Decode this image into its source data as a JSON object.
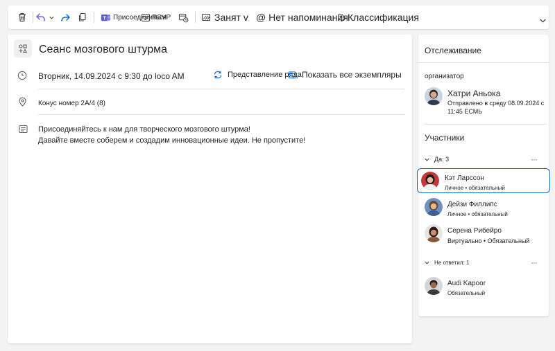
{
  "toolbar": {
    "join_label": "Присоединиться",
    "rsvp_label": "RSVP",
    "busy_label": "Занят v",
    "reminder_label": "@ Нет напоминания",
    "classify_label": "Классификация"
  },
  "event": {
    "title": "Сеанс мозгового штурма",
    "datetime": "Вторник, 14.09.2024 с 9:30 до loco AM",
    "series_view_label": "Представление ряда",
    "show_all_label": "Показать все экземпляры",
    "location": "Конус номер 2A/4 (8)",
    "body_line1": "Присоединяйтесь к нам для творческого мозгового штурма!",
    "body_line2": "Давайте вместе соберем и создадим инновационные идеи. Не пропустите!"
  },
  "tracking": {
    "title": "Отслеживание",
    "organizer_heading": "организатор",
    "organizer_name": "Хатри Аньока",
    "organizer_sent_1": "Отправлено в среду 08.09.2024 с",
    "organizer_sent_2": "11:45 ЕСМЬ",
    "attendees_heading": "Участники",
    "group_yes": "Да: 3",
    "group_noreply": "Не ответил: 1",
    "more_glyph": "···",
    "attendees": [
      {
        "name": "Кэт Ларссон",
        "detail": "Личное • обязательный"
      },
      {
        "name": "Дейзи Филлипс",
        "detail": "Личное • обязательный"
      },
      {
        "name": "Серена Рибейро",
        "detail": "Виртуально • Обязательный"
      },
      {
        "name": "Audi Kapoor",
        "detail": "Обязательный"
      }
    ]
  },
  "colors": {
    "accent": "#0f6cbd",
    "teams_purple": "#5b5fc7",
    "reply_purple": "#7160e8"
  }
}
